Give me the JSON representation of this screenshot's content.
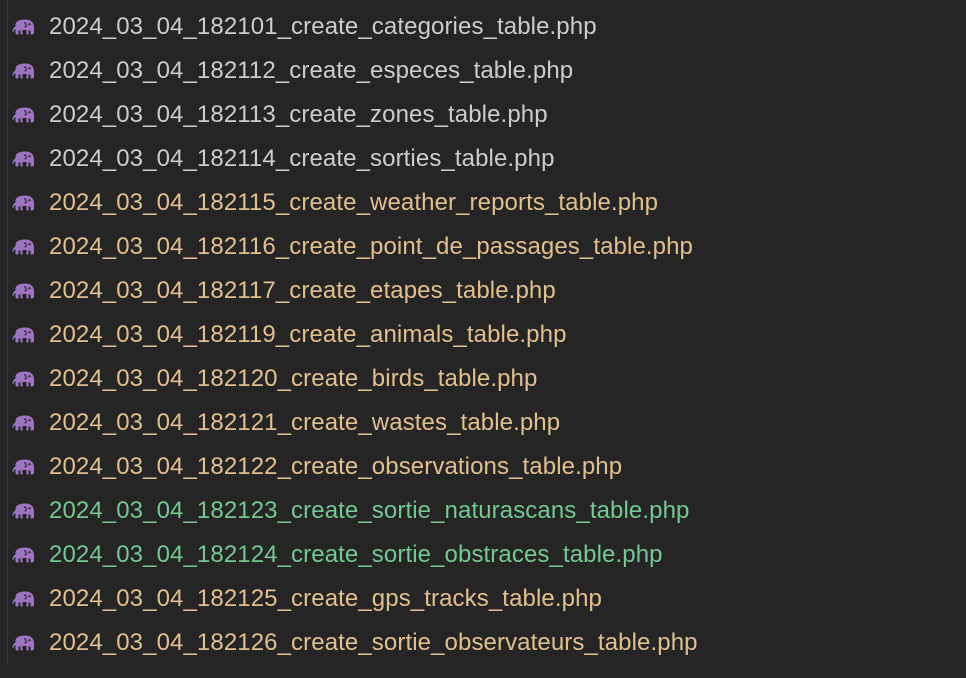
{
  "colors": {
    "background": "#252526",
    "icon": "#a074c4",
    "unchanged": "#cccccc",
    "modified": "#e2c08d",
    "untracked": "#73c991"
  },
  "files": [
    {
      "name": "2024_03_04_182101_create_categories_table.php",
      "status": "unchanged",
      "icon": "elephant-icon"
    },
    {
      "name": "2024_03_04_182112_create_especes_table.php",
      "status": "unchanged",
      "icon": "elephant-icon"
    },
    {
      "name": "2024_03_04_182113_create_zones_table.php",
      "status": "unchanged",
      "icon": "elephant-icon"
    },
    {
      "name": "2024_03_04_182114_create_sorties_table.php",
      "status": "unchanged",
      "icon": "elephant-icon"
    },
    {
      "name": "2024_03_04_182115_create_weather_reports_table.php",
      "status": "modified",
      "icon": "elephant-icon"
    },
    {
      "name": "2024_03_04_182116_create_point_de_passages_table.php",
      "status": "modified",
      "icon": "elephant-icon"
    },
    {
      "name": "2024_03_04_182117_create_etapes_table.php",
      "status": "modified",
      "icon": "elephant-icon"
    },
    {
      "name": "2024_03_04_182119_create_animals_table.php",
      "status": "modified",
      "icon": "elephant-icon"
    },
    {
      "name": "2024_03_04_182120_create_birds_table.php",
      "status": "modified",
      "icon": "elephant-icon"
    },
    {
      "name": "2024_03_04_182121_create_wastes_table.php",
      "status": "modified",
      "icon": "elephant-icon"
    },
    {
      "name": "2024_03_04_182122_create_observations_table.php",
      "status": "modified",
      "icon": "elephant-icon"
    },
    {
      "name": "2024_03_04_182123_create_sortie_naturascans_table.php",
      "status": "untracked",
      "icon": "elephant-icon"
    },
    {
      "name": "2024_03_04_182124_create_sortie_obstraces_table.php",
      "status": "untracked",
      "icon": "elephant-icon"
    },
    {
      "name": "2024_03_04_182125_create_gps_tracks_table.php",
      "status": "modified",
      "icon": "elephant-icon"
    },
    {
      "name": "2024_03_04_182126_create_sortie_observateurs_table.php",
      "status": "modified",
      "icon": "elephant-icon"
    }
  ]
}
